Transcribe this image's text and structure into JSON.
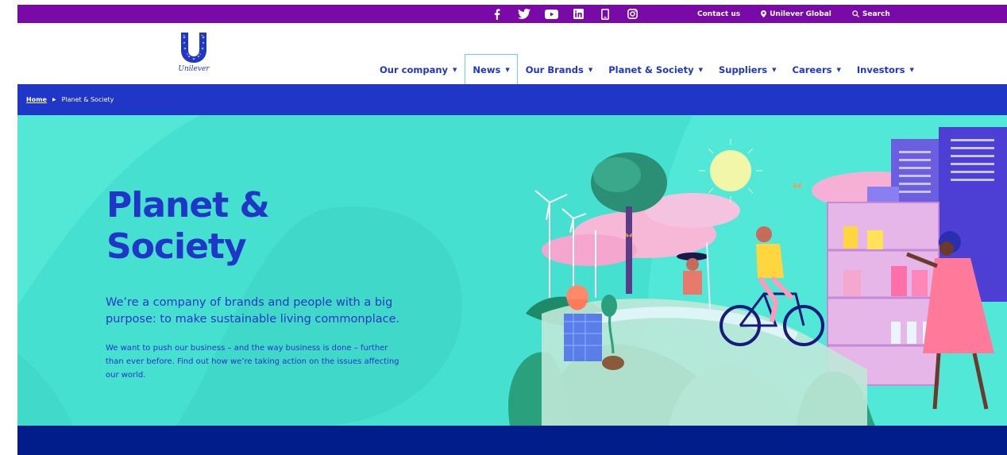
{
  "utility_bar": {
    "social_icons": [
      "facebook-icon",
      "twitter-icon",
      "youtube-icon",
      "linkedin-icon",
      "phone-icon",
      "instagram-icon"
    ],
    "contact_label": "Contact us",
    "global_label": "Unilever Global",
    "search_label": "Search"
  },
  "header": {
    "logo_text": "Unilever",
    "nav": [
      {
        "label": "Our company"
      },
      {
        "label": "News"
      },
      {
        "label": "Our Brands"
      },
      {
        "label": "Planet & Society"
      },
      {
        "label": "Suppliers"
      },
      {
        "label": "Careers"
      },
      {
        "label": "Investors"
      }
    ]
  },
  "breadcrumb": {
    "home": "Home",
    "current": "Planet & Society"
  },
  "hero": {
    "title_line1": "Planet &",
    "title_line2": "Society",
    "lead": "We’re a company of brands and people with a big purpose: to make sustainable living commonplace.",
    "body": "We want to push our business – and the way business is done – further than ever before. Find out how we’re taking action on the issues affecting our world."
  },
  "colors": {
    "utility_purple": "#7a0aa8",
    "brand_blue": "#1f36c7",
    "hero_teal": "#45e0cf",
    "footer_navy": "#001d8a"
  }
}
